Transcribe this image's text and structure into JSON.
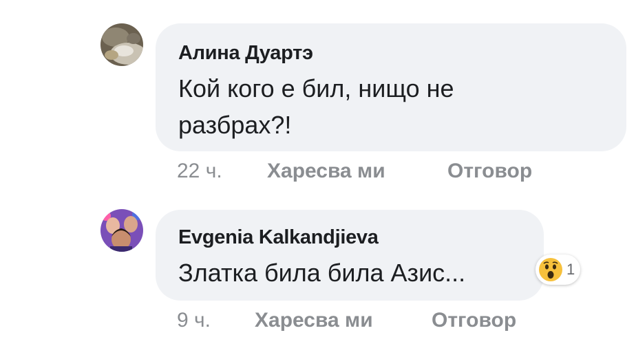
{
  "comments": [
    {
      "author": "Алина Дуартэ",
      "text_lines": [
        "Кой кого е бил, нищо не",
        "разбрах?!"
      ],
      "time": "22 ч.",
      "like_label": "Харесва ми",
      "reply_label": "Отговор",
      "avatar_icon": "profile-photo"
    },
    {
      "author": "Evgenia Kalkandjieva",
      "text_lines": [
        "Златка била била Азис..."
      ],
      "time": "9 ч.",
      "like_label": "Харесва ми",
      "reply_label": "Отговор",
      "avatar_icon": "profile-photo",
      "reaction": {
        "icon": "wow-emoji-icon",
        "count": "1"
      }
    }
  ],
  "colors": {
    "bubble": "#f0f2f5",
    "text": "#1c1e21",
    "meta": "#8a8d91",
    "emoji_yellow": "#f7c13c"
  }
}
